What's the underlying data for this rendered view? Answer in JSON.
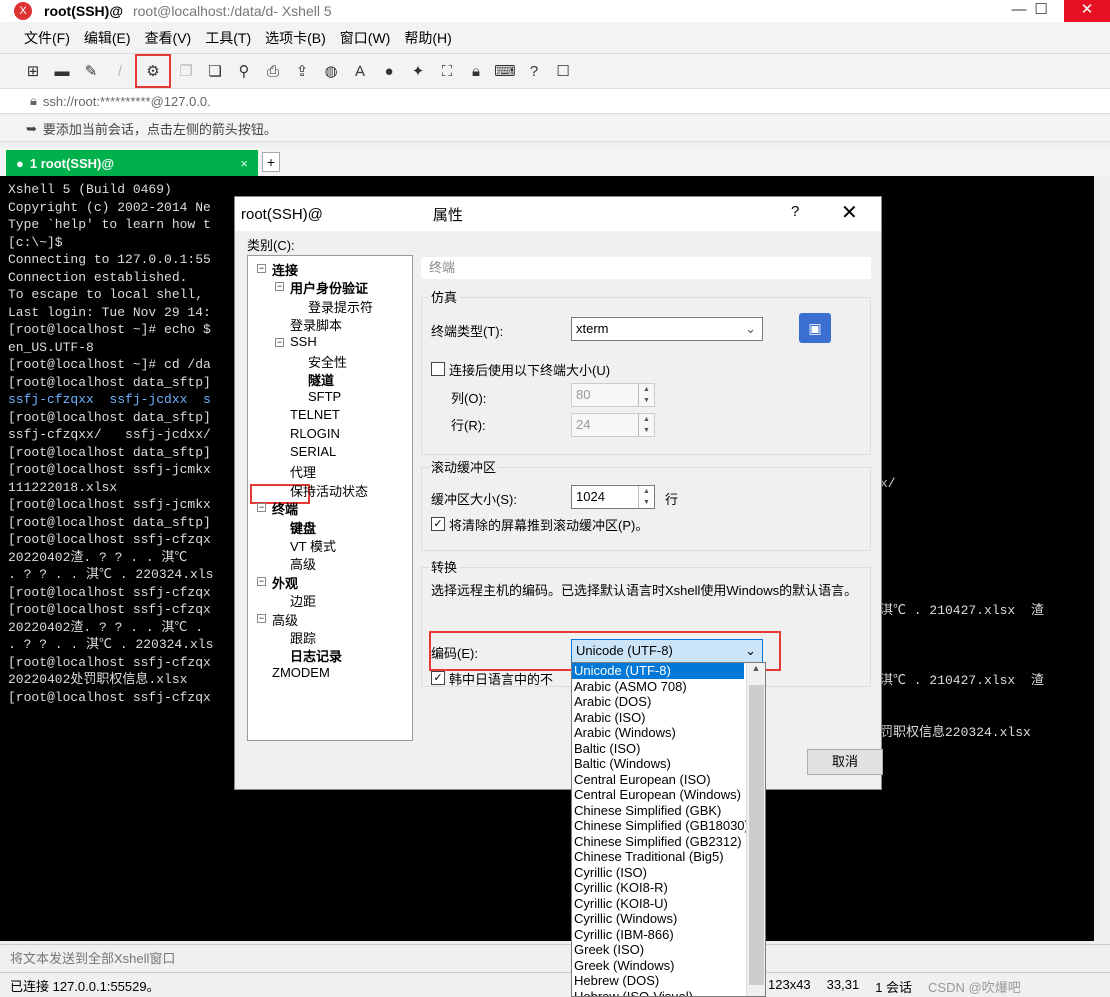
{
  "window": {
    "title_main": "root(SSH)@",
    "title_path": "root@localhost:/data/d",
    "title_app": " - Xshell 5",
    "minimize": "—",
    "maximize": "☐",
    "close": "✕"
  },
  "menu": [
    "文件(F)",
    "编辑(E)",
    "查看(V)",
    "工具(T)",
    "选项卡(B)",
    "窗口(W)",
    "帮助(H)"
  ],
  "address": "ssh://root:**********@127.0.0.",
  "hint": "要添加当前会话，点击左侧的箭头按钮。",
  "tab": {
    "label": "1 root(SSH)@",
    "close": "×",
    "add": "+"
  },
  "terminal_lines": [
    "Xshell 5 (Build 0469)",
    "Copyright (c) 2002-2014 Ne",
    "",
    "Type `help' to learn how t",
    "[c:\\~]$",
    "",
    "Connecting to 127.0.0.1:55",
    "Connection established.",
    "To escape to local shell,",
    "",
    "Last login: Tue Nov 29 14:",
    "[root@localhost ~]# echo $",
    "en_US.UTF-8",
    "[root@localhost ~]# cd /da",
    "[root@localhost data_sftp]",
    "ssfj-cfzqxx  ssfj-jcdxx  s",
    "[root@localhost data_sftp]",
    "ssfj-cfzqxx/   ssfj-jcdxx/",
    "[root@localhost data_sftp]",
    "[root@localhost ssfj-jcmkx",
    "111222018.xlsx",
    "[root@localhost ssfj-jcmkx",
    "[root@localhost data_sftp]",
    "[root@localhost ssfj-cfzqx",
    "20220402渣. ? ? . . 淇℃",
    ". ? ? . . 淇℃ . 220324.xls",
    "[root@localhost ssfj-cfzqx",
    "[root@localhost ssfj-cfzqx",
    "20220402渣. ? ? . . 淇℃ .",
    ". ? ? . . 淇℃ . 220324.xls",
    "[root@localhost ssfj-cfzqx",
    "20220402处罚职权信息.xlsx",
    "[root@localhost ssfj-cfzqx"
  ],
  "terminal_right": [
    "x/",
    "",
    "",
    "",
    "",
    "",
    "",
    "淇℃ . 210427.xlsx  渣",
    "",
    "",
    "",
    "淇℃ . 210427.xlsx  渣",
    "",
    "",
    "罚职权信息220324.xlsx"
  ],
  "input_placeholder": "将文本发送到全部Xshell窗口",
  "status": {
    "connected": "已连接 127.0.0.1:55529。",
    "size": "123x43",
    "pos": "33,31",
    "sessions": "1 会话",
    "watermark": "CSDN @吹爆吧"
  },
  "dialog": {
    "title": "root(SSH)@",
    "title_suffix": "属性",
    "help": "?",
    "close": "✕",
    "category_label": "类别(C):",
    "tree": [
      {
        "label": "连接",
        "bold": true,
        "level": 0,
        "exp": "−"
      },
      {
        "label": "用户身份验证",
        "bold": true,
        "level": 1,
        "exp": "−"
      },
      {
        "label": "登录提示符",
        "bold": false,
        "level": 2
      },
      {
        "label": "登录脚本",
        "bold": false,
        "level": 1
      },
      {
        "label": "SSH",
        "bold": false,
        "level": 1,
        "exp": "−"
      },
      {
        "label": "安全性",
        "bold": false,
        "level": 2
      },
      {
        "label": "隧道",
        "bold": true,
        "level": 2
      },
      {
        "label": "SFTP",
        "bold": false,
        "level": 2
      },
      {
        "label": "TELNET",
        "bold": false,
        "level": 1
      },
      {
        "label": "RLOGIN",
        "bold": false,
        "level": 1
      },
      {
        "label": "SERIAL",
        "bold": false,
        "level": 1
      },
      {
        "label": "代理",
        "bold": false,
        "level": 1
      },
      {
        "label": "保持活动状态",
        "bold": false,
        "level": 1
      },
      {
        "label": "终端",
        "bold": true,
        "level": 0,
        "exp": "−"
      },
      {
        "label": "键盘",
        "bold": true,
        "level": 1
      },
      {
        "label": "VT 模式",
        "bold": false,
        "level": 1
      },
      {
        "label": "高级",
        "bold": false,
        "level": 1
      },
      {
        "label": "外观",
        "bold": true,
        "level": 0,
        "exp": "−"
      },
      {
        "label": "边距",
        "bold": false,
        "level": 1
      },
      {
        "label": "高级",
        "bold": false,
        "level": 0,
        "exp": "−"
      },
      {
        "label": "跟踪",
        "bold": false,
        "level": 1
      },
      {
        "label": "日志记录",
        "bold": true,
        "level": 1
      },
      {
        "label": "ZMODEM",
        "bold": false,
        "level": 0
      }
    ],
    "panel_title": "终端",
    "emulation": {
      "title": "仿真",
      "term_type_label": "终端类型(T):",
      "term_type_value": "xterm",
      "use_size_label": "连接后使用以下终端大小(U)",
      "cols_label": "列(O):",
      "cols_value": "80",
      "rows_label": "行(R):",
      "rows_value": "24"
    },
    "scrollback": {
      "title": "滚动缓冲区",
      "size_label": "缓冲区大小(S):",
      "size_value": "1024",
      "unit": "行",
      "push_label": "将清除的屏幕推到滚动缓冲区(P)。"
    },
    "translation": {
      "title": "转换",
      "desc": "选择远程主机的编码。已选择默认语言时Xshell使用Windows的默认语言。",
      "encoding_label": "编码(E):",
      "encoding_value": "Unicode (UTF-8)",
      "cjk_label": "韩中日语言中的不"
    },
    "cancel": "取消"
  },
  "encoding_options": [
    "Unicode (UTF-8)",
    "Arabic (ASMO 708)",
    "Arabic (DOS)",
    "Arabic (ISO)",
    "Arabic (Windows)",
    "Baltic (ISO)",
    "Baltic (Windows)",
    "Central European (ISO)",
    "Central European (Windows)",
    "Chinese Simplified (GBK)",
    "Chinese Simplified (GB18030)",
    "Chinese Simplified (GB2312)",
    "Chinese Traditional (Big5)",
    "Cyrillic (ISO)",
    "Cyrillic (KOI8-R)",
    "Cyrillic (KOI8-U)",
    "Cyrillic (Windows)",
    "Cyrillic (IBM-866)",
    "Greek (ISO)",
    "Greek (Windows)",
    "Hebrew (DOS)",
    "Hebrew (ISO-Visual)"
  ]
}
